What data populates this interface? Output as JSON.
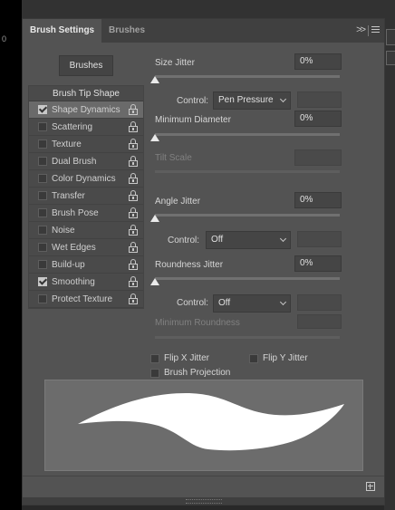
{
  "tabs": [
    {
      "label": "Brush Settings",
      "active": true
    },
    {
      "label": "Brushes",
      "active": false
    }
  ],
  "ruler_mark": "0",
  "brushes_button": "Brushes",
  "tip_shape_header": "Brush Tip Shape",
  "list_items": [
    {
      "label": "Shape Dynamics",
      "checked": true,
      "selected": true
    },
    {
      "label": "Scattering",
      "checked": false
    },
    {
      "label": "Texture",
      "checked": false
    },
    {
      "label": "Dual Brush",
      "checked": false
    },
    {
      "label": "Color Dynamics",
      "checked": false
    },
    {
      "label": "Transfer",
      "checked": false
    },
    {
      "label": "Brush Pose",
      "checked": false
    },
    {
      "label": "Noise",
      "checked": false
    },
    {
      "label": "Wet Edges",
      "checked": false
    },
    {
      "label": "Build-up",
      "checked": false
    },
    {
      "label": "Smoothing",
      "checked": true
    },
    {
      "label": "Protect Texture",
      "checked": false
    }
  ],
  "size_jitter": {
    "label": "Size Jitter",
    "value": "0%",
    "control_label": "Control:",
    "control_value": "Pen Pressure"
  },
  "min_diameter": {
    "label": "Minimum Diameter",
    "value": "0%"
  },
  "tilt_scale": {
    "label": "Tilt Scale"
  },
  "angle_jitter": {
    "label": "Angle Jitter",
    "value": "0%",
    "control_label": "Control:",
    "control_value": "Off"
  },
  "roundness_jitter": {
    "label": "Roundness Jitter",
    "value": "0%",
    "control_label": "Control:",
    "control_value": "Off"
  },
  "min_roundness": {
    "label": "Minimum Roundness"
  },
  "options": {
    "flip_x": "Flip X Jitter",
    "flip_y": "Flip Y Jitter",
    "projection": "Brush Projection"
  },
  "colors": {
    "panel": "#535353",
    "accent_text": "#d6d6d6",
    "stroke": "#ffffff"
  }
}
